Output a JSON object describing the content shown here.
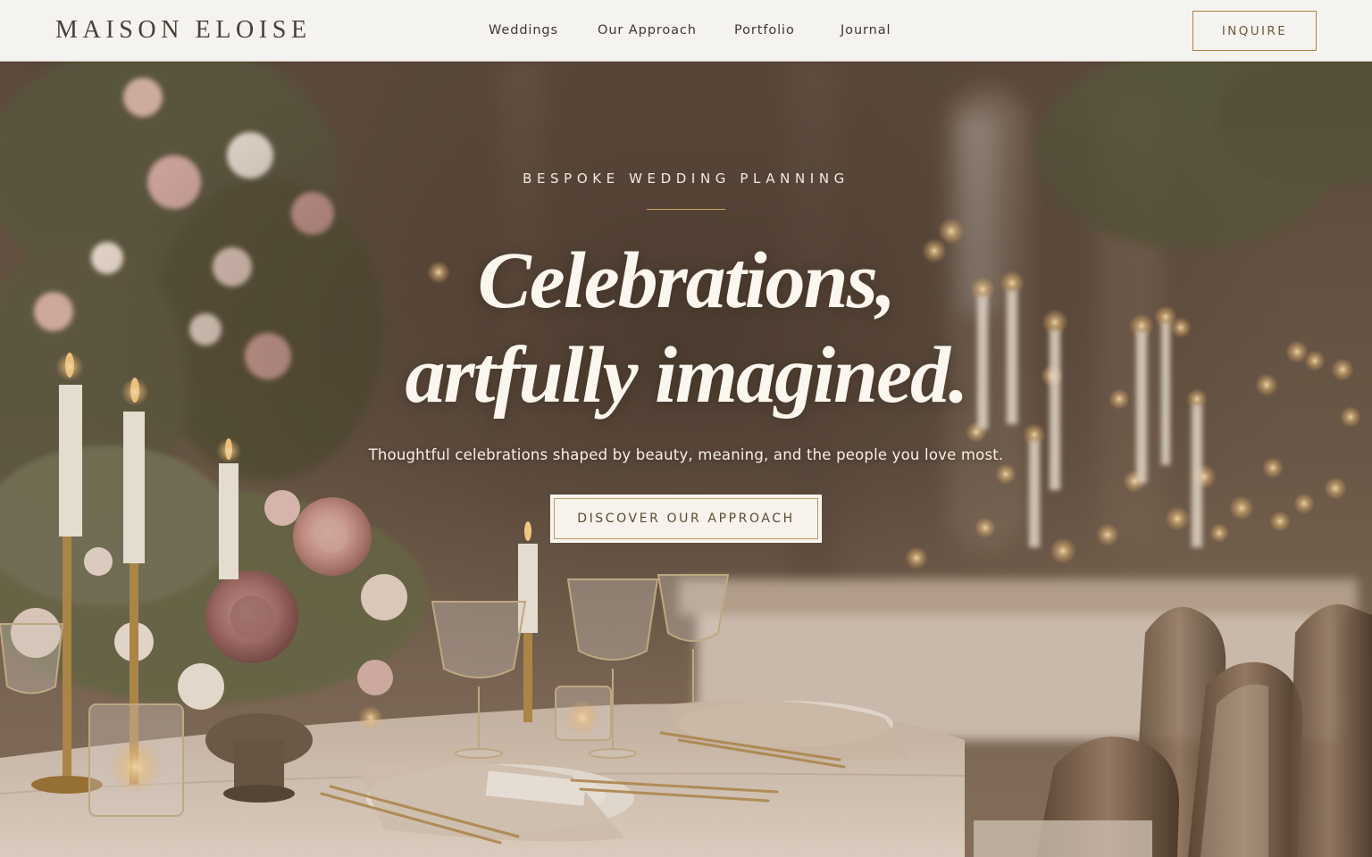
{
  "brand": {
    "name": "MAISON ELOISE"
  },
  "nav": {
    "links": [
      "Weddings",
      "Our Approach",
      "Portfolio",
      "Journal"
    ],
    "cta_label": "INQUIRE"
  },
  "hero": {
    "eyebrow": "BESPOKE WEDDING PLANNING",
    "headline_line1": "Celebrations,",
    "headline_line2": "artfully imagined.",
    "subtext": "Thoughtful celebrations shaped by beauty, meaning, and the people you love most.",
    "cta_label": "DISCOVER OUR APPROACH",
    "background_image": "candlelit-wedding-reception-table"
  },
  "colors": {
    "nav_background": "#f5f3ef",
    "brand_text": "#4a4139",
    "accent_gold": "#a8843f",
    "hero_text": "#fbf6ee",
    "cta_background": "#f7f3ec"
  }
}
